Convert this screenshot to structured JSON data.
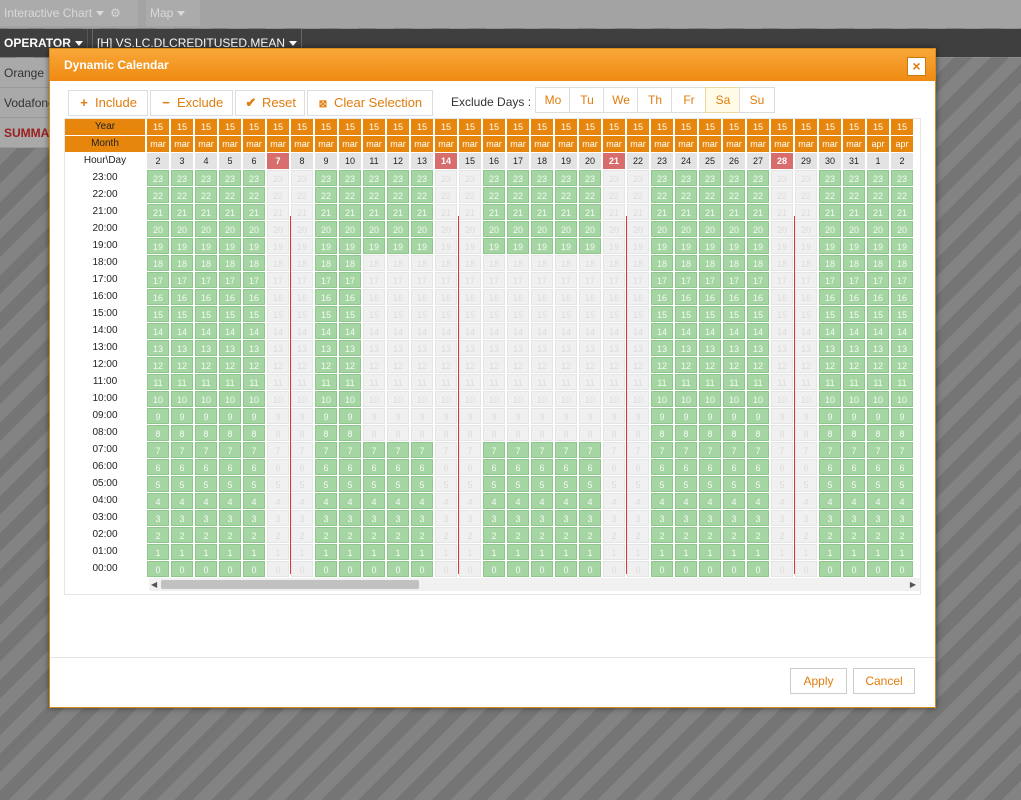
{
  "topbar": {
    "tab1": "Interactive Chart",
    "tab2": "Map"
  },
  "operator_bar": {
    "col1": "OPERATOR",
    "col2": "[H] VS.LC.DLCREDITUSED.MEAN"
  },
  "sidebar": [
    "Orange",
    "Vodafone",
    "SUMMARY"
  ],
  "dialog": {
    "title": "Dynamic Calendar",
    "close_label": "×",
    "toolbar": {
      "include": "Include",
      "exclude": "Exclude",
      "reset": "Reset",
      "clear": "Clear Selection"
    },
    "exclude_days_label": "Exclude Days :",
    "days": [
      {
        "label": "Mo",
        "selected": false
      },
      {
        "label": "Tu",
        "selected": false
      },
      {
        "label": "We",
        "selected": false
      },
      {
        "label": "Th",
        "selected": false
      },
      {
        "label": "Fr",
        "selected": false
      },
      {
        "label": "Sa",
        "selected": true
      },
      {
        "label": "Su",
        "selected": false
      }
    ],
    "row_labels": {
      "year": "Year",
      "month": "Month",
      "hourday": "Hour\\Day"
    },
    "columns": [
      {
        "year": "15",
        "month": "mar",
        "day": "2",
        "weekend": false,
        "excluded": false
      },
      {
        "year": "15",
        "month": "mar",
        "day": "3",
        "weekend": false,
        "excluded": false
      },
      {
        "year": "15",
        "month": "mar",
        "day": "4",
        "weekend": false,
        "excluded": false
      },
      {
        "year": "15",
        "month": "mar",
        "day": "5",
        "weekend": false,
        "excluded": false
      },
      {
        "year": "15",
        "month": "mar",
        "day": "6",
        "weekend": false,
        "excluded": false
      },
      {
        "year": "15",
        "month": "mar",
        "day": "7",
        "weekend": true,
        "excluded": true
      },
      {
        "year": "15",
        "month": "mar",
        "day": "8",
        "weekend": true,
        "excluded": false
      },
      {
        "year": "15",
        "month": "mar",
        "day": "9",
        "weekend": false,
        "excluded": false
      },
      {
        "year": "15",
        "month": "mar",
        "day": "10",
        "weekend": false,
        "excluded": false
      },
      {
        "year": "15",
        "month": "mar",
        "day": "11",
        "weekend": false,
        "excluded": false
      },
      {
        "year": "15",
        "month": "mar",
        "day": "12",
        "weekend": false,
        "excluded": false
      },
      {
        "year": "15",
        "month": "mar",
        "day": "13",
        "weekend": false,
        "excluded": false
      },
      {
        "year": "15",
        "month": "mar",
        "day": "14",
        "weekend": true,
        "excluded": true
      },
      {
        "year": "15",
        "month": "mar",
        "day": "15",
        "weekend": true,
        "excluded": false
      },
      {
        "year": "15",
        "month": "mar",
        "day": "16",
        "weekend": false,
        "excluded": false
      },
      {
        "year": "15",
        "month": "mar",
        "day": "17",
        "weekend": false,
        "excluded": false
      },
      {
        "year": "15",
        "month": "mar",
        "day": "18",
        "weekend": false,
        "excluded": false
      },
      {
        "year": "15",
        "month": "mar",
        "day": "19",
        "weekend": false,
        "excluded": false
      },
      {
        "year": "15",
        "month": "mar",
        "day": "20",
        "weekend": false,
        "excluded": false
      },
      {
        "year": "15",
        "month": "mar",
        "day": "21",
        "weekend": true,
        "excluded": true
      },
      {
        "year": "15",
        "month": "mar",
        "day": "22",
        "weekend": true,
        "excluded": false
      },
      {
        "year": "15",
        "month": "mar",
        "day": "23",
        "weekend": false,
        "excluded": false
      },
      {
        "year": "15",
        "month": "mar",
        "day": "24",
        "weekend": false,
        "excluded": false
      },
      {
        "year": "15",
        "month": "mar",
        "day": "25",
        "weekend": false,
        "excluded": false
      },
      {
        "year": "15",
        "month": "mar",
        "day": "26",
        "weekend": false,
        "excluded": false
      },
      {
        "year": "15",
        "month": "mar",
        "day": "27",
        "weekend": false,
        "excluded": false
      },
      {
        "year": "15",
        "month": "mar",
        "day": "28",
        "weekend": true,
        "excluded": true
      },
      {
        "year": "15",
        "month": "mar",
        "day": "29",
        "weekend": true,
        "excluded": false
      },
      {
        "year": "15",
        "month": "mar",
        "day": "30",
        "weekend": false,
        "excluded": false
      },
      {
        "year": "15",
        "month": "mar",
        "day": "31",
        "weekend": false,
        "excluded": false
      },
      {
        "year": "15",
        "month": "apr",
        "day": "1",
        "weekend": false,
        "excluded": false
      },
      {
        "year": "15",
        "month": "apr",
        "day": "2",
        "weekend": false,
        "excluded": false
      }
    ],
    "hours": [
      "23:00",
      "22:00",
      "21:00",
      "20:00",
      "19:00",
      "18:00",
      "17:00",
      "16:00",
      "15:00",
      "14:00",
      "13:00",
      "12:00",
      "11:00",
      "10:00",
      "09:00",
      "08:00",
      "07:00",
      "06:00",
      "05:00",
      "04:00",
      "03:00",
      "02:00",
      "01:00",
      "00:00"
    ],
    "excluded_hour_ranges": [
      "18:00-08:00"
    ],
    "scroll": {
      "left_arrow": "◀",
      "right_arrow": "▶"
    },
    "buttons": {
      "apply": "Apply",
      "cancel": "Cancel"
    }
  }
}
